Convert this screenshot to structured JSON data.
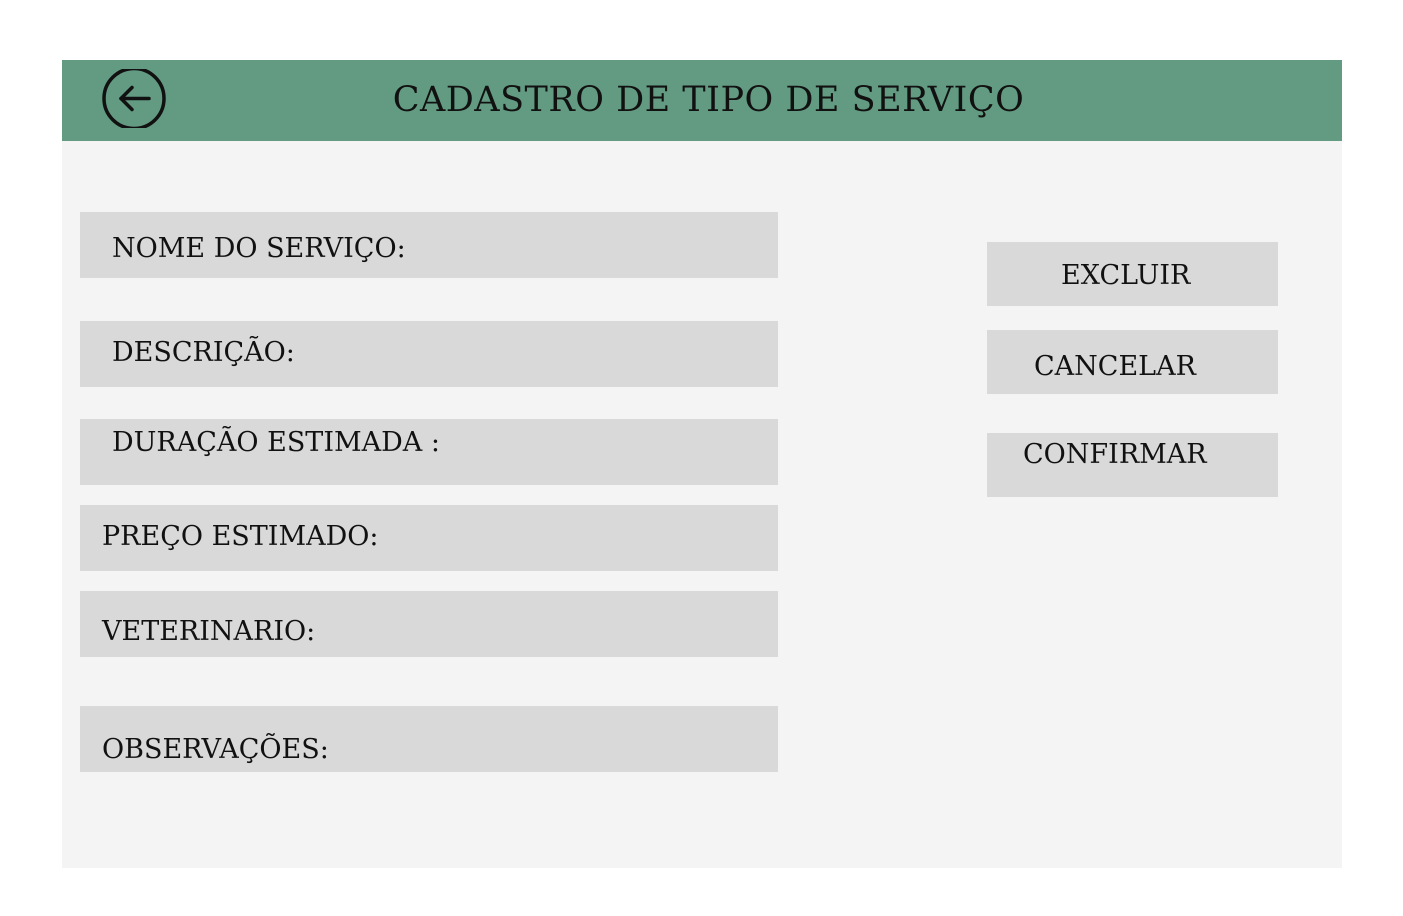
{
  "header": {
    "title": "CADASTRO DE TIPO DE SERVIÇO",
    "back_icon": "arrow-left-circle-icon",
    "color": "#629b82"
  },
  "form": {
    "fields": [
      {
        "label": "NOME DO SERVIÇO:"
      },
      {
        "label": "DESCRIÇÃO:"
      },
      {
        "label": "DURAÇÃO ESTIMADA :"
      },
      {
        "label": "PREÇO ESTIMADO:"
      },
      {
        "label": "VETERINARIO:"
      },
      {
        "label": "OBSERVAÇÕES:"
      }
    ]
  },
  "actions": {
    "delete_label": "EXCLUIR",
    "cancel_label": "CANCELAR",
    "confirm_label": "CONFIRMAR"
  },
  "colors": {
    "panel_background": "#f4f4f4",
    "input_background": "#d9d9d9"
  }
}
